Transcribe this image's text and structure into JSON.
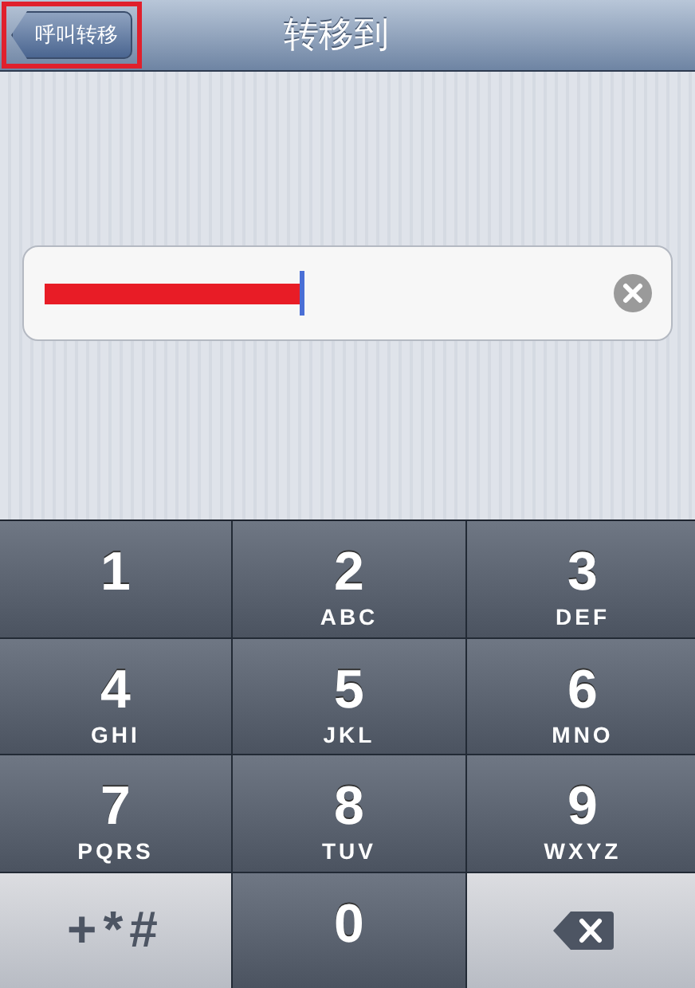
{
  "nav_bar": {
    "back_button": {
      "label": "呼叫转移",
      "highlighted": true
    },
    "title": "转移到"
  },
  "number_field": {
    "redacted": true,
    "focused": true
  },
  "keypad": [
    {
      "kind": "digit",
      "digit": "1"
    },
    {
      "kind": "digit",
      "digit": "2",
      "letters": "ABC"
    },
    {
      "kind": "digit",
      "digit": "3",
      "letters": "DEF"
    },
    {
      "kind": "digit",
      "digit": "4",
      "letters": "GHI"
    },
    {
      "kind": "digit",
      "digit": "5",
      "letters": "JKL"
    },
    {
      "kind": "digit",
      "digit": "6",
      "letters": "MNO"
    },
    {
      "kind": "digit",
      "digit": "7",
      "letters": "PQRS"
    },
    {
      "kind": "digit",
      "digit": "8",
      "letters": "TUV"
    },
    {
      "kind": "digit",
      "digit": "9",
      "letters": "WXYZ"
    },
    {
      "kind": "symbols",
      "digit": "+*#"
    },
    {
      "kind": "digit",
      "digit": "0"
    },
    {
      "kind": "delete"
    }
  ]
}
